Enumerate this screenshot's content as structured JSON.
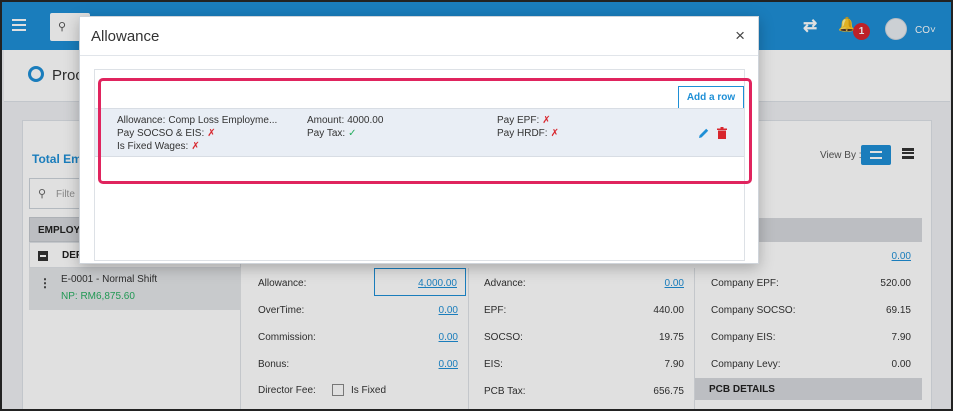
{
  "topbar": {
    "user_initials": "CO",
    "notification_count": "1"
  },
  "page": {
    "title": "Proc"
  },
  "main": {
    "total_label": "Total Em",
    "view_by_label": "View By :",
    "search_placeholder": "Filte",
    "employee_header": "EMPLOY",
    "department_label": "DEF",
    "employee": {
      "name": "E-0001 - Normal Shift",
      "net_pay": "NP: RM6,875.60"
    },
    "col1": [
      {
        "key": "Allowance:",
        "value": "4,000.00"
      },
      {
        "key": "OverTime:",
        "value": "0.00"
      },
      {
        "key": "Commission:",
        "value": "0.00"
      },
      {
        "key": "Bonus:",
        "value": "0.00"
      },
      {
        "key": "Director Fee:",
        "value": ""
      }
    ],
    "director_fee_fixed_label": "Is Fixed",
    "col2": [
      {
        "key": "Advance:",
        "value": "0.00"
      },
      {
        "key": "EPF:",
        "value": "440.00"
      },
      {
        "key": "SOCSO:",
        "value": "19.75"
      },
      {
        "key": "EIS:",
        "value": "7.90"
      },
      {
        "key": "PCB Tax:",
        "value": "656.75"
      }
    ],
    "col3_top_value": "0.00",
    "col3": [
      {
        "key": "Company EPF:",
        "value": "520.00"
      },
      {
        "key": "Company SOCSO:",
        "value": "69.15"
      },
      {
        "key": "Company EIS:",
        "value": "7.90"
      },
      {
        "key": "Company Levy:",
        "value": "0.00"
      }
    ],
    "pcb_details_label": "PCB DETAILS"
  },
  "modal": {
    "title": "Allowance",
    "close_glyph": "×",
    "add_row_label": "Add a row",
    "row": {
      "allowance_label": "Allowance:",
      "allowance_value": "Comp Loss Employme...",
      "amount_label": "Amount:",
      "amount_value": "4000.00",
      "pay_epf_label": "Pay EPF:",
      "pay_epf_value": "✗",
      "pay_socso_eis_label": "Pay SOCSO & EIS:",
      "pay_socso_eis_value": "✗",
      "pay_tax_label": "Pay Tax:",
      "pay_tax_value": "✓",
      "pay_hrdf_label": "Pay HRDF:",
      "pay_hrdf_value": "✗",
      "is_fixed_label": "Is Fixed Wages:",
      "is_fixed_value": "✗"
    }
  },
  "colors": {
    "accent": "#1e8fd6",
    "highlight": "#e0245e",
    "danger": "#d8262d",
    "success": "#27ae60"
  }
}
